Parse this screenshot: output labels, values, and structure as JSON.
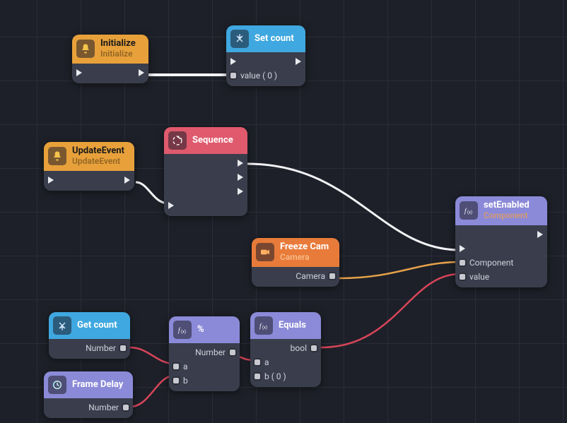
{
  "nodes": {
    "initialize": {
      "title": "Initialize",
      "subtitle": "Initialize",
      "inputs": [],
      "outputs": []
    },
    "setcount": {
      "title": "Set count",
      "inputs": [
        "value ( 0 )"
      ],
      "outputs": []
    },
    "updateevent": {
      "title": "UpdateEvent",
      "subtitle": "UpdateEvent",
      "inputs": [],
      "outputs": []
    },
    "sequence": {
      "title": "Sequence",
      "inputs": [],
      "outputs": []
    },
    "setenabled": {
      "title": "setEnabled",
      "subtitle": "Component",
      "inputs": [
        "Component",
        "value"
      ],
      "outputs": []
    },
    "freezecam": {
      "title": "Freeze Cam",
      "subtitle": "Camera",
      "inputs": [],
      "outputs": [
        "Camera"
      ]
    },
    "getcount": {
      "title": "Get count",
      "inputs": [],
      "outputs": [
        "Number"
      ]
    },
    "mod": {
      "title": "%",
      "inputs": [
        "a",
        "b"
      ],
      "outputs": [
        "Number"
      ]
    },
    "equals": {
      "title": "Equals",
      "inputs": [
        "a",
        "b ( 0 )"
      ],
      "outputs": [
        "bool"
      ]
    },
    "framedelay": {
      "title": "Frame Delay",
      "inputs": [],
      "outputs": [
        "Number"
      ]
    }
  },
  "icons": {
    "bell": "bell-icon",
    "var": "var-icon",
    "seq": "seq-icon",
    "fx": "fx-icon",
    "cam": "camera-icon",
    "delay": "delay-icon",
    "varget": "varget-icon"
  }
}
